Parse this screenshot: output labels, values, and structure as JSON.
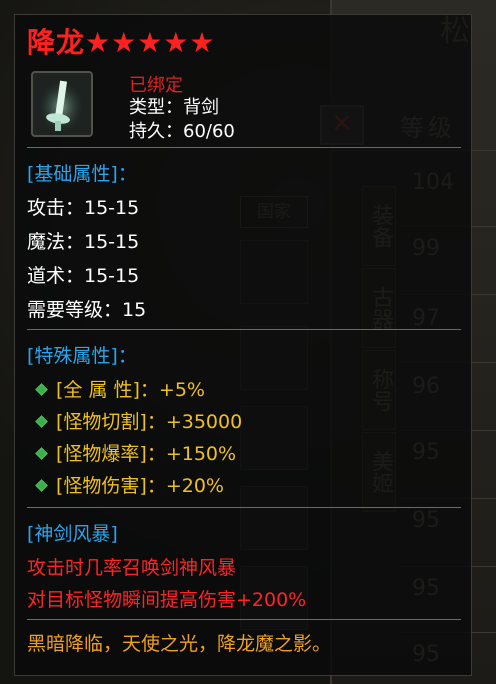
{
  "background": {
    "header_label": "等级",
    "title_char": "松",
    "close_glyph": "✕",
    "guojia_label": "国家",
    "tabs": [
      "装备",
      "古器",
      "称号",
      "美姬"
    ],
    "levels": [
      "104",
      "99",
      "97",
      "96",
      "95",
      "95",
      "95",
      "95"
    ]
  },
  "item": {
    "name": "降龙★★★★★",
    "bound": "已绑定",
    "type": "类型：背剑",
    "durability": "持久：60/60"
  },
  "base_section": {
    "header": "[基础属性]：",
    "stats": [
      "攻击：15-15",
      "魔法：15-15",
      "道术：15-15",
      "需要等级：15"
    ]
  },
  "special_section": {
    "header": "[特殊属性]：",
    "stats": [
      "[全 属 性]：+5%",
      "[怪物切割]：+35000",
      "[怪物爆率]：+150%",
      "[怪物伤害]：+20%"
    ]
  },
  "skill_section": {
    "header": "[神剑风暴]",
    "lines": [
      "攻击时几率召唤剑神风暴",
      "对目标怪物瞬间提高伤害+200%"
    ]
  },
  "flavor": "黑暗降临，天使之光，降龙魔之影。",
  "colors": {
    "title": "#ff2020",
    "section": "#2aa4ee",
    "special": "#f0c020",
    "skill": "#ff2424",
    "flavor": "#f0a020"
  }
}
